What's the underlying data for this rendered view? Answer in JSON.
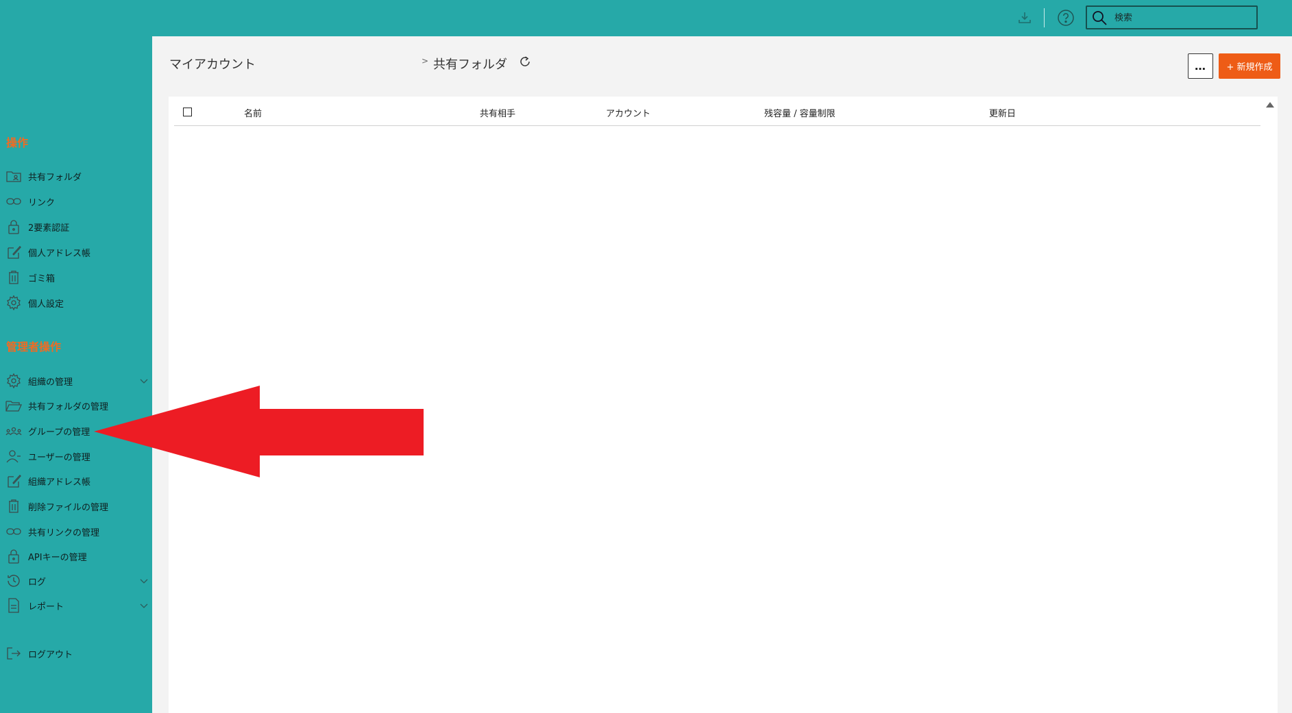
{
  "topbar": {
    "download_icon": "download-icon",
    "help_icon": "help-icon",
    "search": {
      "placeholder": "検索",
      "value": ""
    }
  },
  "sidebar": {
    "operations_title": "操作",
    "operations": [
      {
        "label": "共有フォルダ",
        "icon": "folder-user-icon"
      },
      {
        "label": "リンク",
        "icon": "link-icon"
      },
      {
        "label": "2要素認証",
        "icon": "lock-icon"
      },
      {
        "label": "個人アドレス帳",
        "icon": "edit-icon"
      },
      {
        "label": "ゴミ箱",
        "icon": "trash-icon"
      },
      {
        "label": "個人設定",
        "icon": "gear-icon"
      }
    ],
    "admin_title": "管理者操作",
    "admin": [
      {
        "label": "組織の管理",
        "icon": "gear-icon",
        "expandable": true
      },
      {
        "label": "共有フォルダの管理",
        "icon": "folder-open-icon"
      },
      {
        "label": "グループの管理",
        "icon": "group-icon"
      },
      {
        "label": "ユーザーの管理",
        "icon": "user-icon"
      },
      {
        "label": "組織アドレス帳",
        "icon": "edit-icon"
      },
      {
        "label": "削除ファイルの管理",
        "icon": "trash-icon"
      },
      {
        "label": "共有リンクの管理",
        "icon": "link-icon"
      },
      {
        "label": "APIキーの管理",
        "icon": "lock-icon"
      },
      {
        "label": "ログ",
        "icon": "history-icon",
        "expandable": true
      },
      {
        "label": "レポート",
        "icon": "document-icon",
        "expandable": true
      }
    ],
    "logout": {
      "label": "ログアウト",
      "icon": "logout-icon"
    }
  },
  "main": {
    "breadcrumb": [
      "マイアカウント",
      "共有フォルダ"
    ],
    "more_label": "…",
    "new_button_label": "+ 新規作成",
    "table": {
      "columns": [
        "名前",
        "共有相手",
        "アカウント",
        "残容量 / 容量制限",
        "更新日"
      ],
      "rows": []
    }
  },
  "colors": {
    "brand_teal": "#26a9a8",
    "accent_orange": "#ee5c16",
    "section_title_orange": "#f26b21",
    "annotation_red": "#ed1c24"
  }
}
